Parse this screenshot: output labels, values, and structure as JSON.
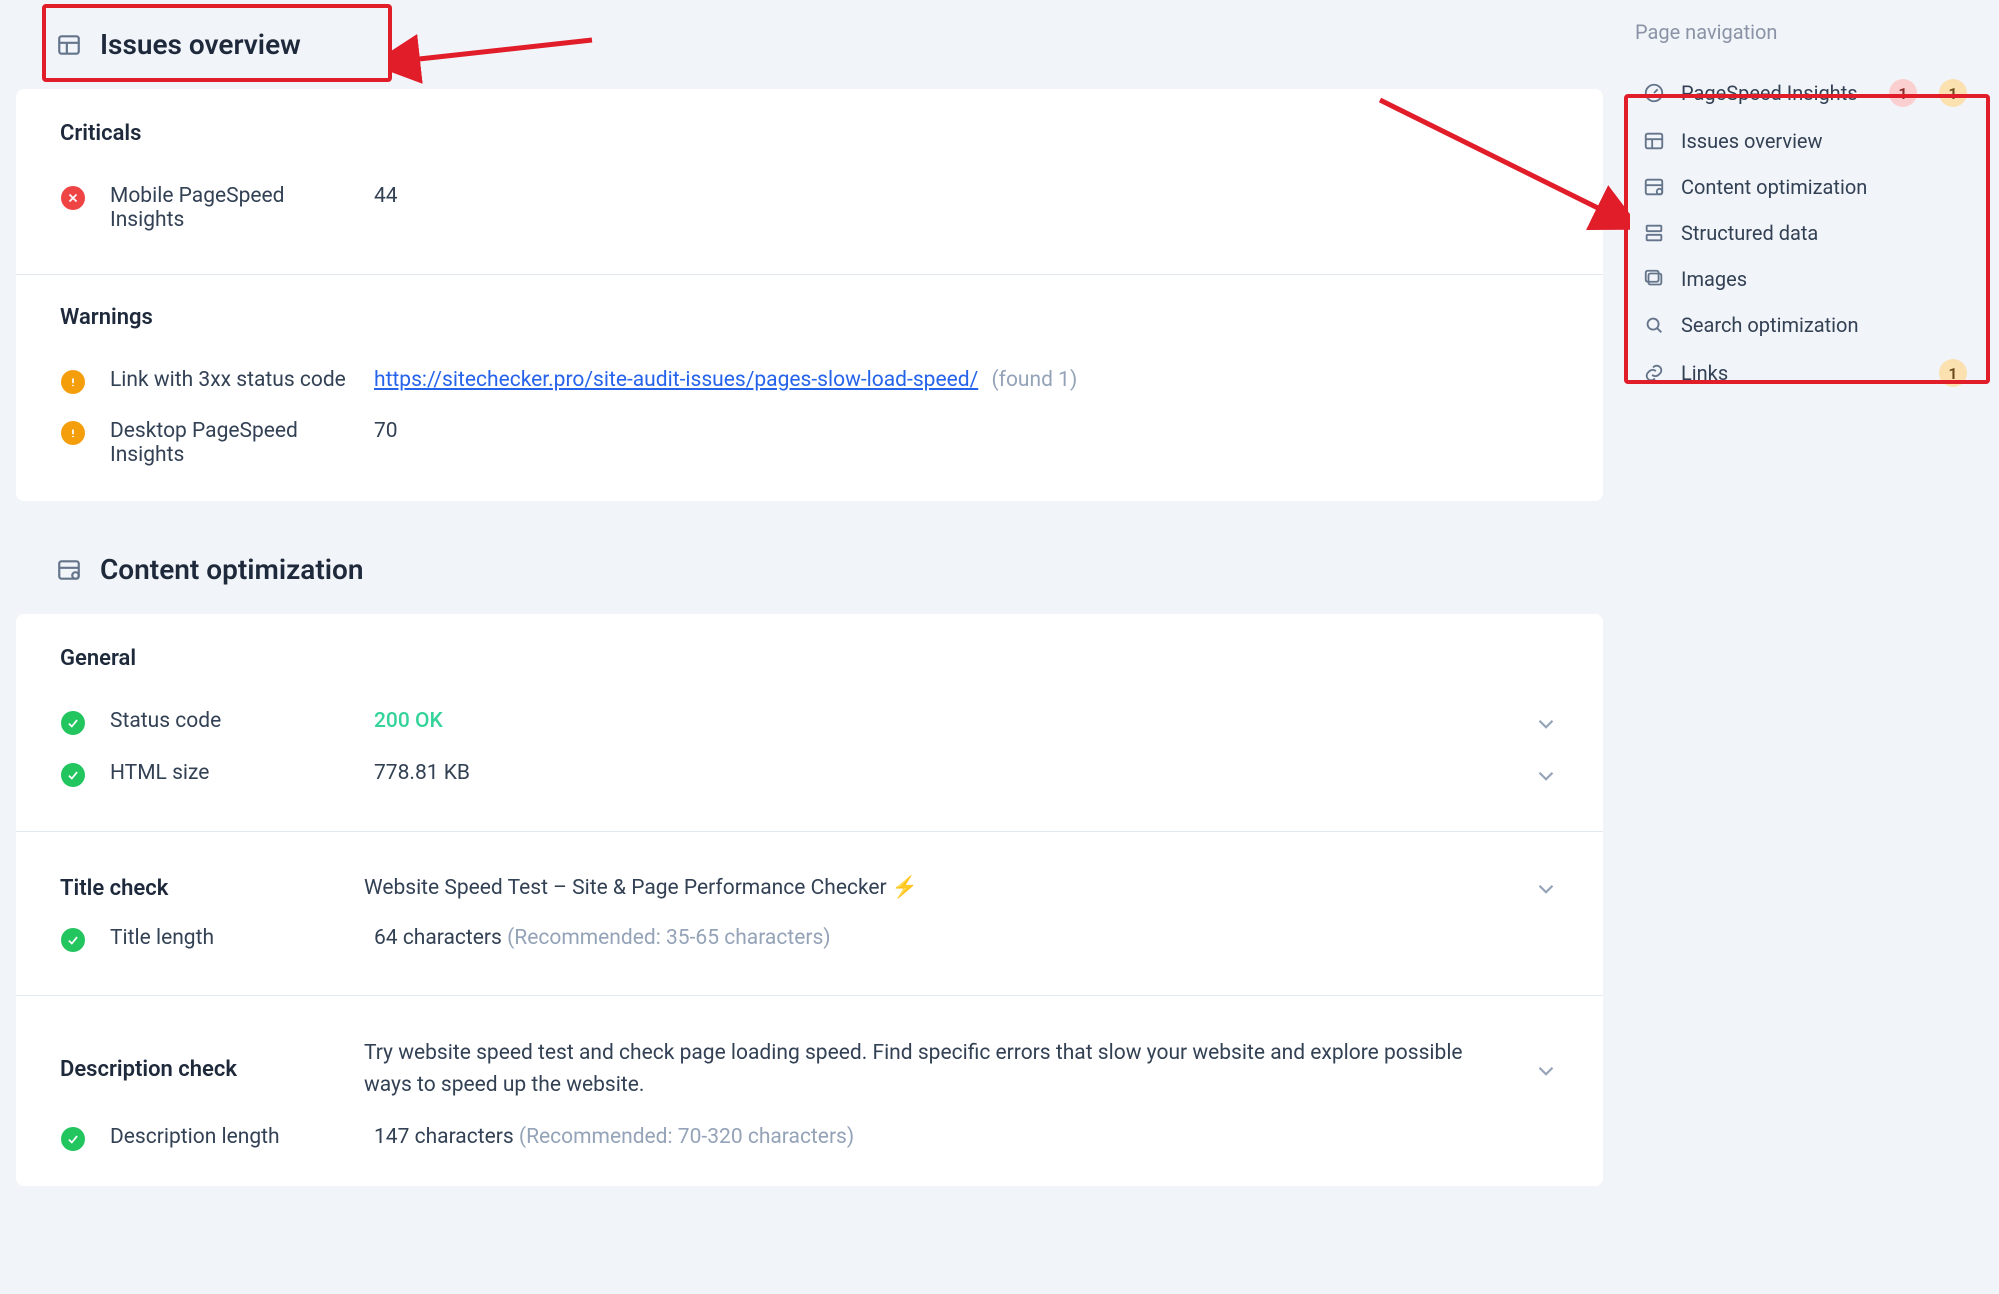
{
  "sections": {
    "issues_overview": {
      "title": "Issues overview",
      "criticals": {
        "heading": "Criticals",
        "items": [
          {
            "label": "Mobile PageSpeed Insights",
            "value": "44"
          }
        ]
      },
      "warnings": {
        "heading": "Warnings",
        "items": [
          {
            "label": "Link with 3xx status code",
            "link": "https://sitechecker.pro/site-audit-issues/pages-slow-load-speed/",
            "found": "(found 1)"
          },
          {
            "label": "Desktop PageSpeed Insights",
            "value": "70"
          }
        ]
      }
    },
    "content_opt": {
      "title": "Content optimization",
      "general": {
        "heading": "General",
        "items": [
          {
            "label": "Status code",
            "value": "200 OK",
            "status": "ok"
          },
          {
            "label": "HTML size",
            "value": "778.81 KB"
          }
        ]
      },
      "title_check": {
        "heading": "Title check",
        "header_value": "Website Speed Test – Site & Page Performance Checker ⚡",
        "items": [
          {
            "label": "Title length",
            "value": "64 characters ",
            "hint": "(Recommended: 35-65 characters)"
          }
        ]
      },
      "desc_check": {
        "heading": "Description check",
        "header_value": "Try website speed test and check page loading speed. Find specific errors that slow your website and explore possible ways to speed up the website.",
        "items": [
          {
            "label": "Description length",
            "value": "147 characters ",
            "hint": "(Recommended: 70-320 characters)"
          }
        ]
      }
    }
  },
  "nav": {
    "title": "Page navigation",
    "items": [
      {
        "label": "PageSpeed Insights",
        "icon": "gauge",
        "badges": [
          {
            "text": "1",
            "c": "pink"
          },
          {
            "text": "1",
            "c": "orange"
          }
        ]
      },
      {
        "label": "Issues overview",
        "icon": "layout"
      },
      {
        "label": "Content optimization",
        "icon": "layout-gear"
      },
      {
        "label": "Structured data",
        "icon": "stack"
      },
      {
        "label": "Images",
        "icon": "images"
      },
      {
        "label": "Search optimization",
        "icon": "search"
      },
      {
        "label": "Links",
        "icon": "link",
        "badges": [
          {
            "text": "1",
            "c": "orange"
          }
        ]
      }
    ]
  }
}
